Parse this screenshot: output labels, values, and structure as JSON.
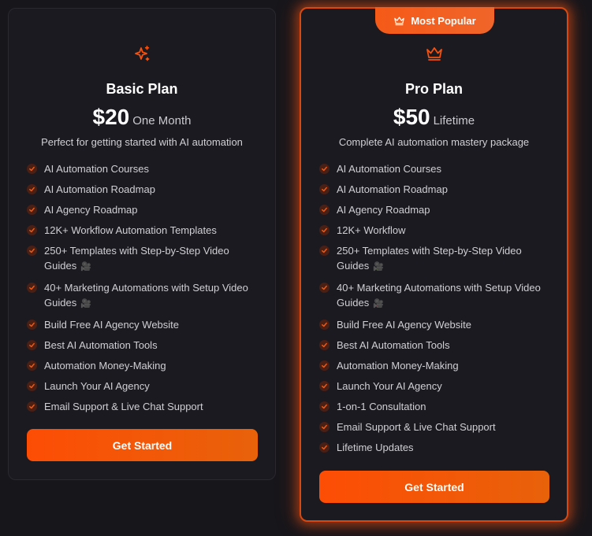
{
  "colors": {
    "accent": "#f5520f",
    "card_bg": "#1b1a20",
    "page_bg": "#17161b"
  },
  "plans": [
    {
      "title": "Basic Plan",
      "price": "$20",
      "period": "One Month",
      "description": "Perfect for getting started with AI automation",
      "icon": "sparkle-icon",
      "features": [
        "AI Automation Courses",
        "AI Automation Roadmap",
        "AI Agency Roadmap",
        "12K+ Workflow Automation Templates",
        "250+ Templates with Step-by-Step Video Guides",
        "40+ Marketing Automations with Setup Video Guides",
        "Build Free AI Agency Website",
        "Best AI Automation Tools",
        "Automation Money-Making",
        "Launch Your AI Agency",
        "Email Support & Live Chat Support"
      ],
      "button": "Get Started"
    },
    {
      "title": "Pro Plan",
      "price": "$50",
      "period": "Lifetime",
      "description": "Complete AI automation mastery package",
      "icon": "crown-icon",
      "badge": "Most Popular",
      "features": [
        "AI Automation Courses",
        "AI Automation Roadmap",
        "AI Agency Roadmap",
        "12K+ Workflow",
        "250+ Templates with Step-by-Step Video Guides",
        "40+ Marketing Automations with Setup Video Guides",
        "Build Free AI Agency Website",
        "Best AI Automation Tools",
        "Automation Money-Making",
        "Launch Your AI Agency",
        "1-on-1 Consultation",
        "Email Support & Live Chat Support",
        "Lifetime Updates"
      ],
      "button": "Get Started"
    }
  ]
}
